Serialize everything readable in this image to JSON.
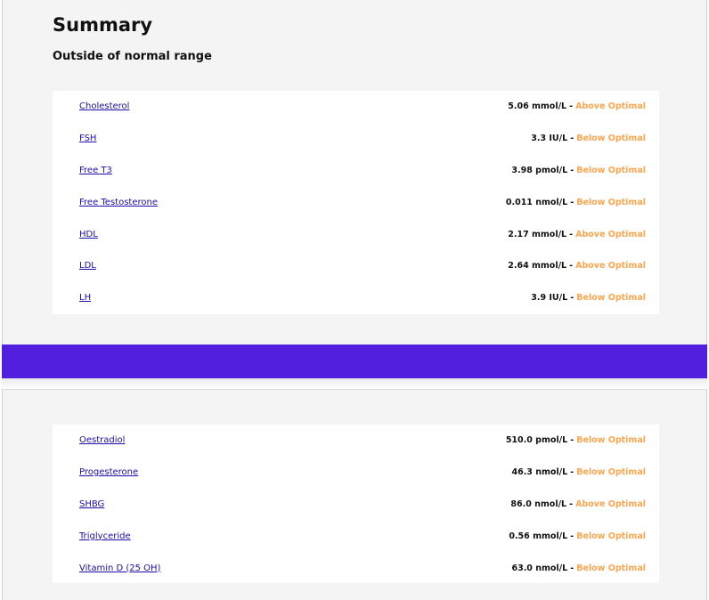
{
  "summary": {
    "title": "Summary",
    "subtitle": "Outside of normal range"
  },
  "colors": {
    "band": "#531fdf",
    "status": "#ffa54f",
    "link": "#1a0dab"
  },
  "markers_page1": [
    {
      "name": "Cholesterol",
      "value": "5.06 mmol/L",
      "status": "Above Optimal"
    },
    {
      "name": "FSH",
      "value": "3.3 IU/L",
      "status": "Below Optimal"
    },
    {
      "name": "Free T3",
      "value": "3.98 pmol/L",
      "status": "Below Optimal"
    },
    {
      "name": "Free Testosterone",
      "value": "0.011 nmol/L",
      "status": "Below Optimal"
    },
    {
      "name": "HDL",
      "value": "2.17 mmol/L",
      "status": "Above Optimal"
    },
    {
      "name": "LDL",
      "value": "2.64 mmol/L",
      "status": "Above Optimal"
    },
    {
      "name": "LH",
      "value": "3.9 IU/L",
      "status": "Below Optimal"
    }
  ],
  "markers_page2": [
    {
      "name": "Oestradiol",
      "value": "510.0 pmol/L",
      "status": "Below Optimal"
    },
    {
      "name": "Progesterone",
      "value": "46.3 nmol/L",
      "status": "Below Optimal"
    },
    {
      "name": "SHBG",
      "value": "86.0 nmol/L",
      "status": "Above Optimal"
    },
    {
      "name": "Triglyceride",
      "value": "0.56 mmol/L",
      "status": "Below Optimal"
    },
    {
      "name": "Vitamin D (25 OH)",
      "value": "63.0 nmol/L",
      "status": "Below Optimal"
    }
  ]
}
